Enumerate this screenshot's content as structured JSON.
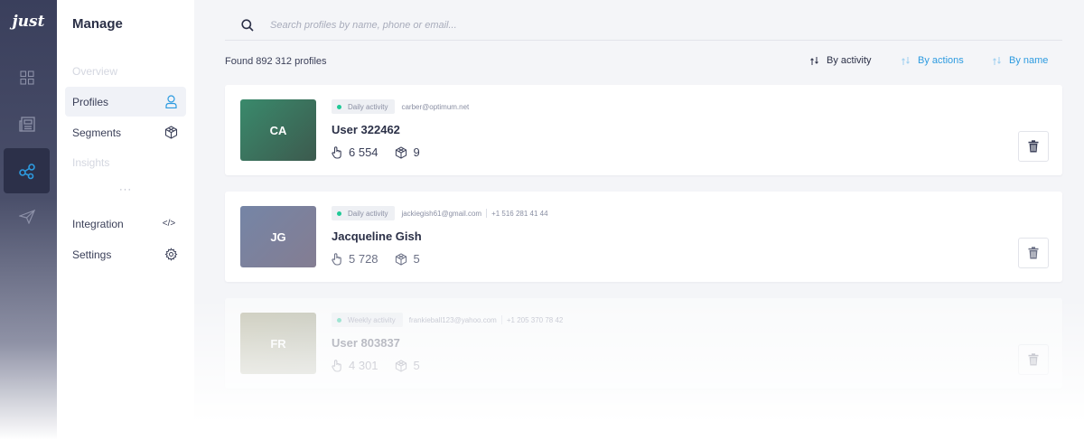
{
  "app": {
    "logo": "just"
  },
  "rail": {
    "items": [
      {
        "icon": "dashboard-grid-icon",
        "active": false
      },
      {
        "icon": "news-icon",
        "active": false
      },
      {
        "icon": "connections-icon",
        "active": true
      },
      {
        "icon": "paper-plane-icon",
        "active": false
      }
    ]
  },
  "sidebar": {
    "title": "Manage",
    "items": [
      {
        "label": "Overview",
        "icon": "",
        "state": "disabled"
      },
      {
        "label": "Profiles",
        "icon": "user-icon",
        "state": "active"
      },
      {
        "label": "Segments",
        "icon": "cube-icon",
        "state": "normal"
      },
      {
        "label": "Insights",
        "icon": "",
        "state": "disabled"
      },
      {
        "label": "Integration",
        "icon": "code-icon",
        "code_text": "</>",
        "state": "normal"
      },
      {
        "label": "Settings",
        "icon": "gear-icon",
        "state": "normal"
      }
    ],
    "more": "···"
  },
  "search": {
    "placeholder": "Search profiles by name, phone or email...",
    "value": ""
  },
  "results": {
    "found_label": "Found 892 312 profiles"
  },
  "sort": {
    "options": [
      {
        "label": "By activity",
        "active": true
      },
      {
        "label": "By actions",
        "active": false
      },
      {
        "label": "By name",
        "active": false
      }
    ]
  },
  "colors": {
    "accent": "#2d9be0",
    "activity_dot": "#20c997",
    "rail": "#3a3f5c"
  },
  "profiles": [
    {
      "initials": "CA",
      "name": "User 322462",
      "activity": "Daily activity",
      "email": "carber@optimum.net",
      "phone": "",
      "actions": "6 554",
      "segments": "9",
      "avatar_from": "#3a8a6c",
      "avatar_to": "#3c5a4e"
    },
    {
      "initials": "JG",
      "name": "Jacqueline Gish",
      "activity": "Daily activity",
      "email": "jackiegish61@gmail.com",
      "phone": "+1 516 281 41 44",
      "actions": "5 728",
      "segments": "5",
      "avatar_from": "#7585a6",
      "avatar_to": "#847d92"
    },
    {
      "initials": "FR",
      "name": "User 803837",
      "activity": "Weekly activity",
      "email": "frankieball123@yahoo.com",
      "phone": "+1 205 370 78 42",
      "actions": "4 301",
      "segments": "5",
      "avatar_from": "#a3a17e",
      "avatar_to": "#9a9e86"
    }
  ]
}
